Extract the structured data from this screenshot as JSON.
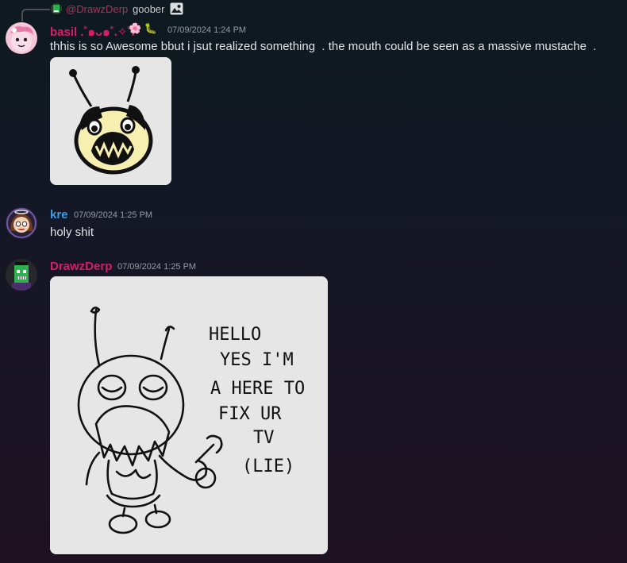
{
  "reply": {
    "username": "@DrawzDerp",
    "text": "goober",
    "attachment_icon": "image-icon"
  },
  "messages": [
    {
      "username": "basil .˚๑ᴗ๑˚.✧˚.",
      "username_emoji": "🌸 🐛",
      "username_color": "#d61f66",
      "timestamp": "07/09/2024 1:24 PM",
      "text": "thhis is so Awesome bbut i jsut realized something  . the mouth could be seen as a massive mustache  .",
      "attachment": "bee-face-drawing"
    },
    {
      "username": "kre",
      "username_color": "#3c9ce0",
      "timestamp": "07/09/2024 1:25 PM",
      "text": "holy shit"
    },
    {
      "username": "DrawzDerp",
      "username_color": "#d61f66",
      "timestamp": "07/09/2024 1:25 PM",
      "attachment": "bug-sketch-drawing",
      "attachment_text": [
        "HELLO",
        "YES I'M",
        "A HERE TO",
        "FIX UR",
        "TV",
        "(LIE)"
      ]
    }
  ]
}
